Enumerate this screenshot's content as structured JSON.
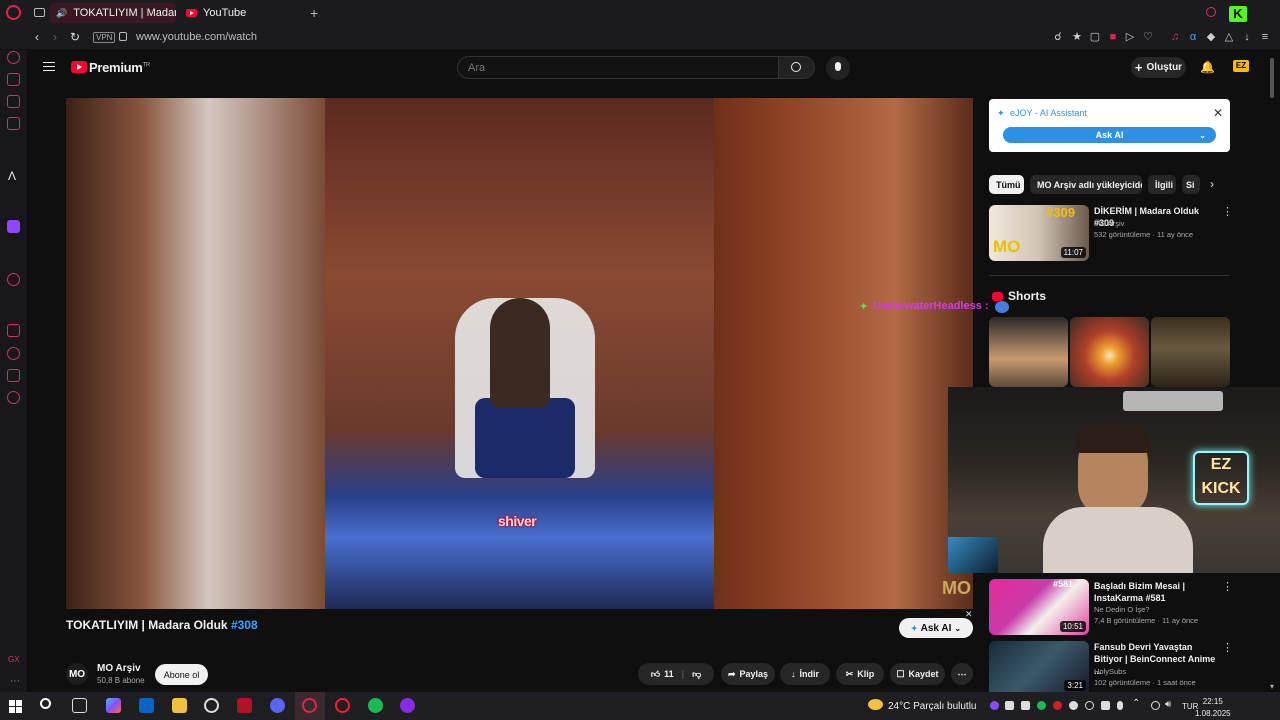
{
  "browser": {
    "active_tab": "TOKATLIYIM | Madara Olduk",
    "second_tab": "YouTube",
    "vpn_label": "VPN",
    "url": "www.youtube.com/watch"
  },
  "header": {
    "logo_text": "Premium",
    "logo_sup": "TR",
    "search_placeholder": "Ara",
    "create_label": "Oluştur"
  },
  "video": {
    "caption": "shiver",
    "watermark": "MO",
    "title": "TOKATLIYIM | Madara Olduk",
    "title_tag": "#308",
    "ask_ai_label": "Ask AI"
  },
  "channel": {
    "avatar_text": "MO",
    "name": "MO Arşiv",
    "subscribers": "50,8 B abone",
    "subscribe_label": "Abone ol"
  },
  "actions": {
    "likes": "11",
    "share": "Paylaş",
    "download": "İndir",
    "clip": "Klip",
    "save": "Kaydet"
  },
  "ejoy": {
    "title": "eJOY - AI Assistant",
    "button": "Ask AI"
  },
  "chips": [
    "Tümü",
    "MO Arşiv adlı yükleyiciden",
    "İlgili",
    "Si"
  ],
  "related": [
    {
      "title": "DİKERİM | Madara Olduk #309",
      "channel": "MO Arşiv",
      "meta": "532 görüntüleme · 11 ay önce",
      "duration": "11:07",
      "badge": "#309"
    },
    {
      "title": "Başladı Bizim Mesai | InstaKarma #581",
      "channel": "Ne Dedin O İşe?",
      "meta": "7,4 B görüntüleme · 11 ay önce",
      "duration": "10:51",
      "badge": "#581"
    },
    {
      "title": "Fansub Devri Yavaştan Bitiyor | BeinConnect Anime ...",
      "channel": "HolySubs",
      "meta": "102 görüntüleme · 1 saat önce",
      "duration": "3:21",
      "badge": ""
    }
  ],
  "shorts_label": "Shorts",
  "chat_overlay": "UnderwaterHeadless :",
  "stream_badge": "EZ KICK",
  "taskbar": {
    "weather": "24°C  Parçalı bulutlu",
    "lang": "TUR",
    "time": "22:15",
    "date": "1.08.2025"
  },
  "colors": {
    "accent": "#ff0033",
    "link": "#3ea6ff",
    "opera_sidebar": "#d6305d",
    "ejoy_blue": "#2f8fe3"
  }
}
